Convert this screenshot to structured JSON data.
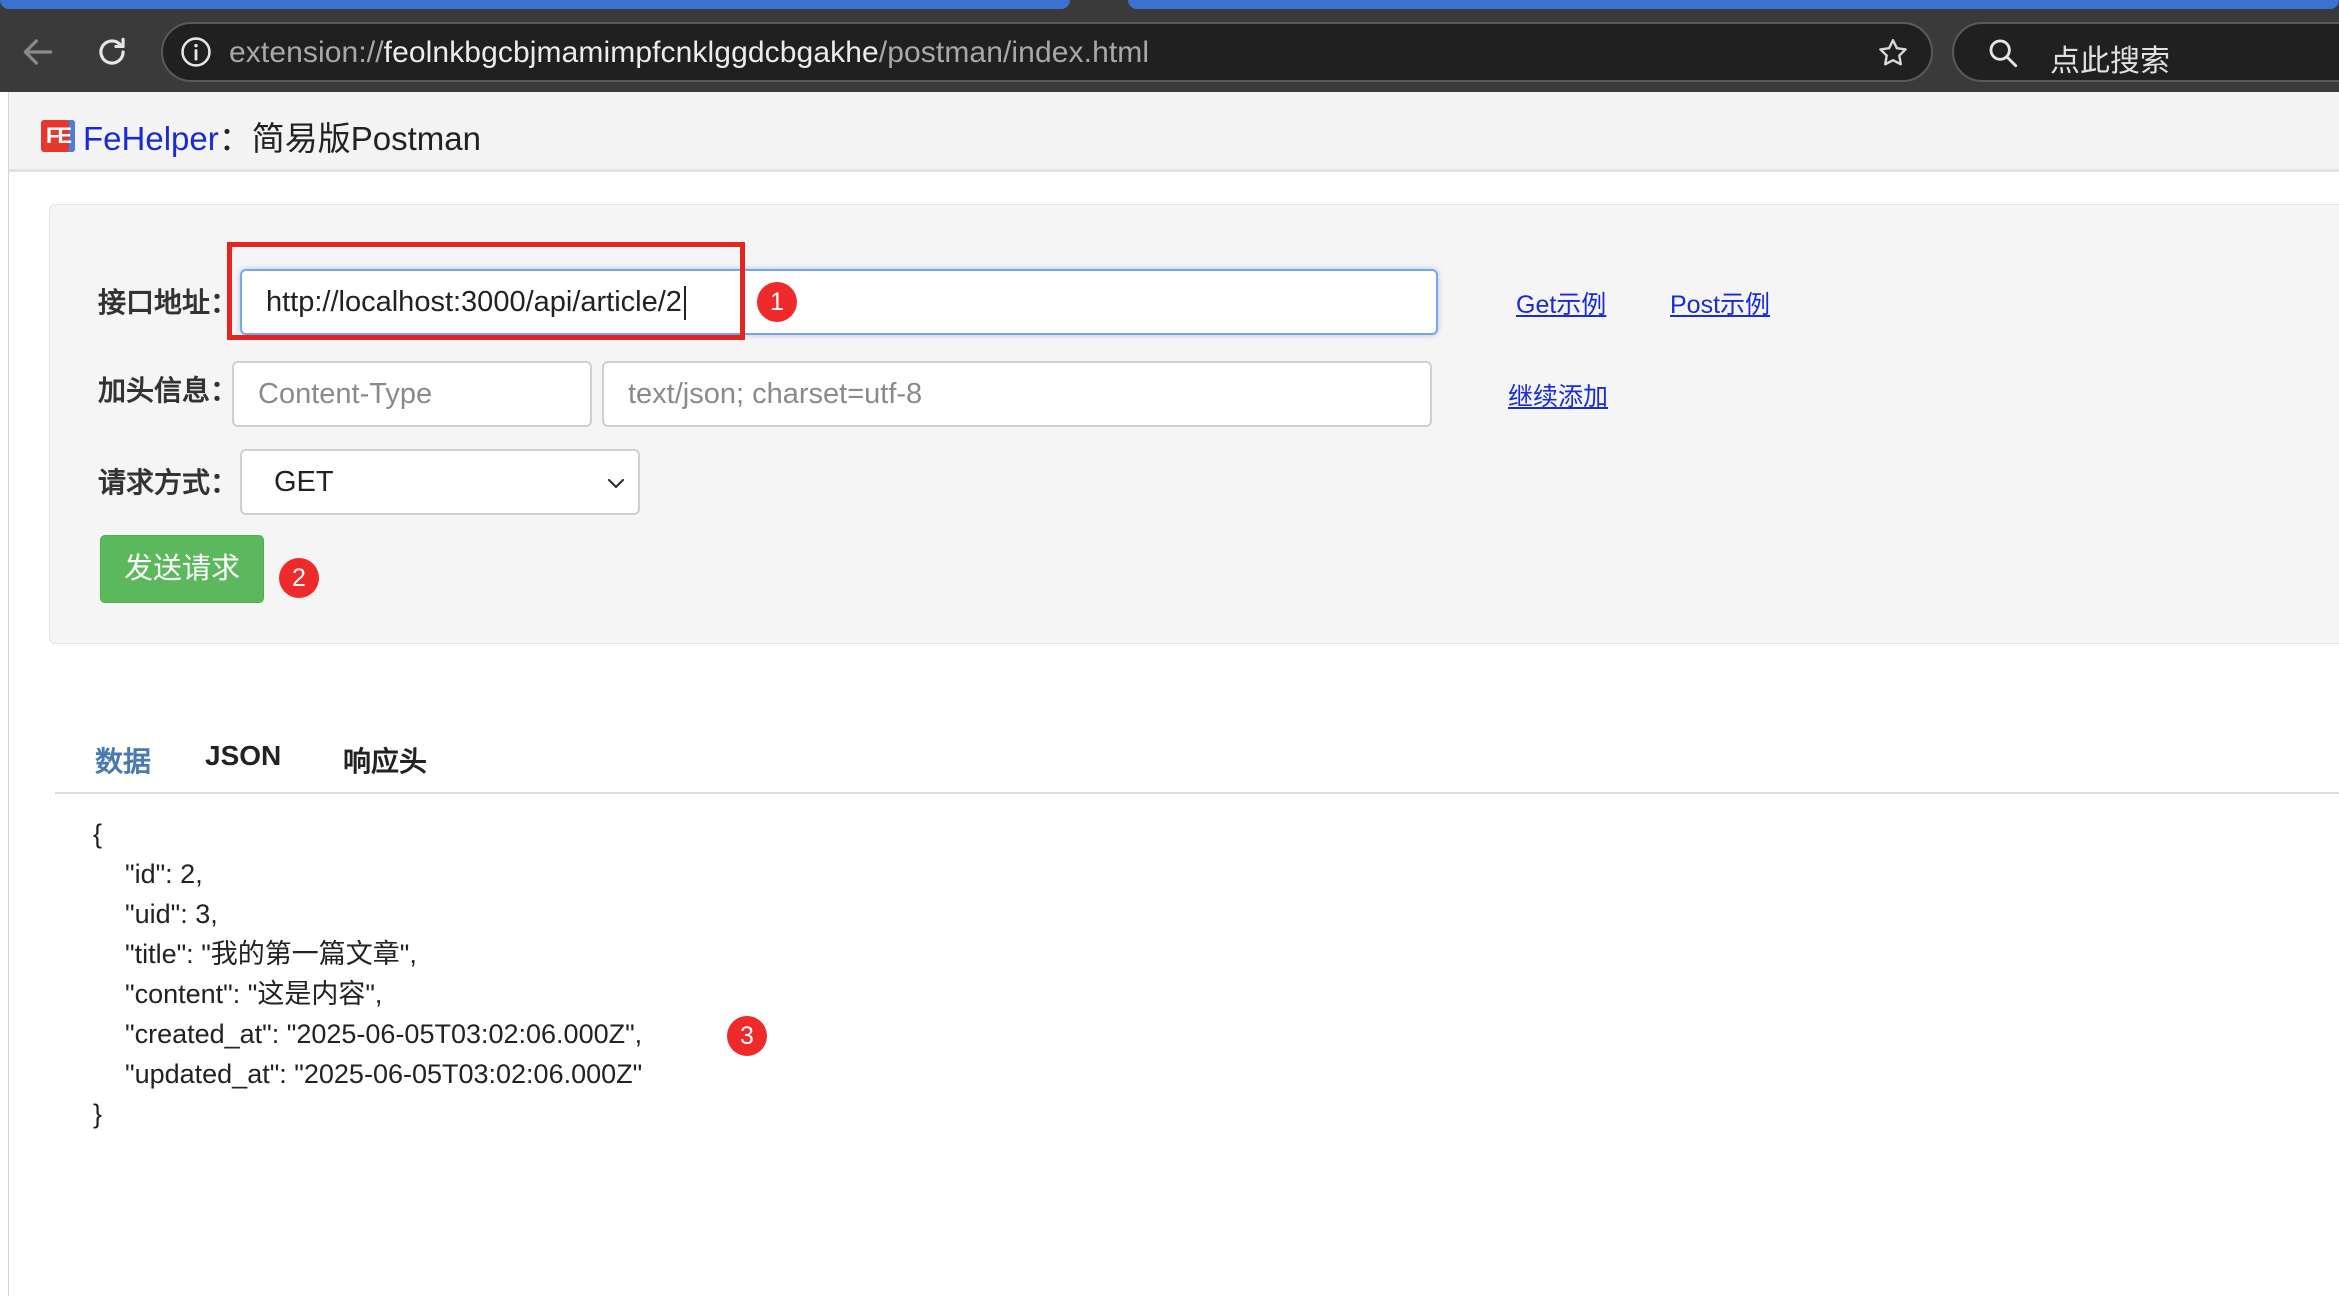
{
  "browser": {
    "url_prefix": "extension://",
    "url_host": "feolnkbgcbjmamimpfcnklggdcbgakhe",
    "url_path": "/postman/index.html",
    "search_placeholder": "点此搜索"
  },
  "header": {
    "logo_text": "FE",
    "brand_name": "FeHelper",
    "separator": "：",
    "title": "简易版Postman"
  },
  "form": {
    "url_label": "接口地址：",
    "url_value": "http://localhost:3000/api/article/2",
    "get_example_link": "Get示例",
    "post_example_link": "Post示例",
    "header_label": "加头信息：",
    "header_key_placeholder": "Content-Type",
    "header_value_placeholder": "text/json; charset=utf-8",
    "add_more_link": "继续添加",
    "method_label": "请求方式：",
    "method_value": "GET",
    "send_button": "发送请求"
  },
  "annotations": {
    "badge_1": "1",
    "badge_2": "2",
    "badge_3": "3",
    "highlight_color": "#e52620"
  },
  "tabs": [
    {
      "label": "数据",
      "active": true
    },
    {
      "label": "JSON",
      "active": false
    },
    {
      "label": "响应头",
      "active": false
    }
  ],
  "response": {
    "open": "{",
    "lines": [
      "\"id\": 2,",
      "\"uid\": 3,",
      "\"title\": \"我的第一篇文章\",",
      "\"content\": \"这是内容\",",
      "\"created_at\": \"2025-06-05T03:02:06.000Z\",",
      "\"updated_at\": \"2025-06-05T03:02:06.000Z\""
    ],
    "close": "}"
  },
  "colors": {
    "accent_blue": "#4a7ab0",
    "link_blue": "#1a2bd6",
    "send_green": "#5cb85c",
    "badge_red": "#ee2a2a"
  }
}
